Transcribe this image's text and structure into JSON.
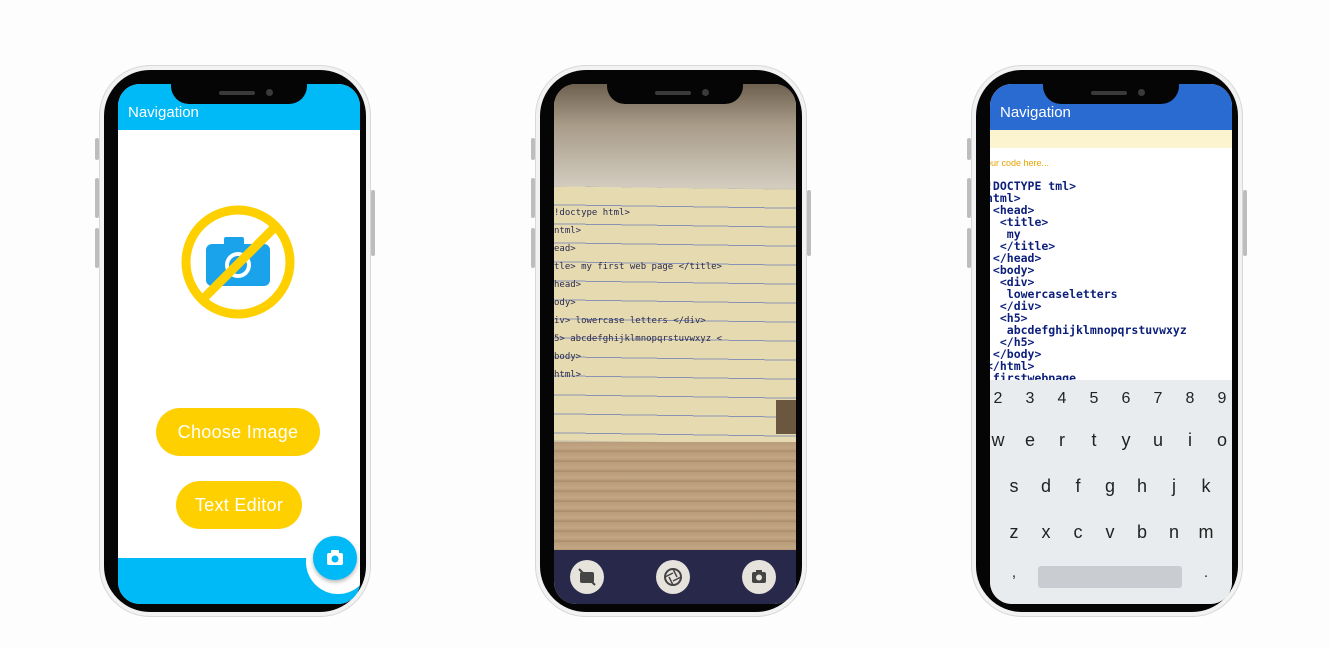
{
  "phone1": {
    "appbar_title": "Navigation",
    "accent_color": "#00b9f7",
    "button_color": "#ffd000",
    "choose_image_label": "Choose Image",
    "text_editor_label": "Text Editor",
    "icons": [
      "no-photo-icon",
      "camera-icon"
    ]
  },
  "phone2": {
    "handwriting": [
      "!doctype html>",
      "ntml>",
      "ead>",
      "tle> my first web page </title>",
      "head>",
      "ody>",
      "iv> lowercase letters </div>",
      "5> abcdefghijklmnopqrstuvwxyz <",
      "body>",
      "html>"
    ],
    "icons": [
      "camera-off-icon",
      "shutter-icon",
      "switch-camera-icon"
    ]
  },
  "phone3": {
    "appbar_title": "Navigation",
    "accent_color": "#2a6bd1",
    "placeholder": "our code here...",
    "code": "!DOCTYPE tml>\nhtml>\n <head>\n  <title>\n   my\n  </title>\n </head>\n <body>\n  <div>\n   lowercaseletters\n  </div>\n  <h5>\n   abcdefghijklmnopqrstuvwxyz\n  </h5>\n </body>\n</html>\n firstwebpage",
    "keyboard": {
      "row_numbers": [
        "2",
        "3",
        "4",
        "5",
        "6",
        "7",
        "8",
        "9"
      ],
      "row_top": [
        "w",
        "e",
        "r",
        "t",
        "y",
        "u",
        "i",
        "o"
      ],
      "row_middle": [
        "s",
        "d",
        "f",
        "g",
        "h",
        "j",
        "k"
      ],
      "row_bottom": [
        "z",
        "x",
        "c",
        "v",
        "b",
        "n",
        "m"
      ],
      "comma": ",",
      "period": "."
    }
  }
}
